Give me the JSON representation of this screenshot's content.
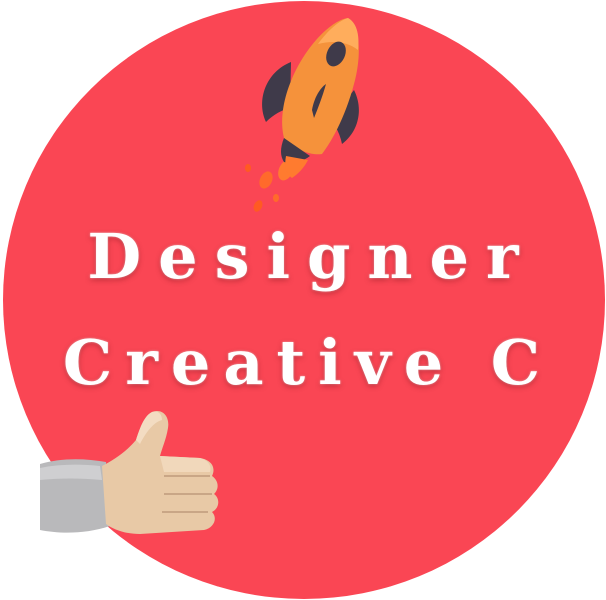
{
  "badge": {
    "line1": "Designer",
    "line2": "Creative C"
  },
  "colors": {
    "background": "#fa4654",
    "text": "#ffffff",
    "rocket_body": "#f5923b",
    "rocket_fins": "#3f3a4a",
    "thumb_skin": "#e8c9a6",
    "sleeve": "#b9b9bb"
  },
  "icons": {
    "rocket": "rocket-icon",
    "thumb": "thumbs-up-icon"
  }
}
